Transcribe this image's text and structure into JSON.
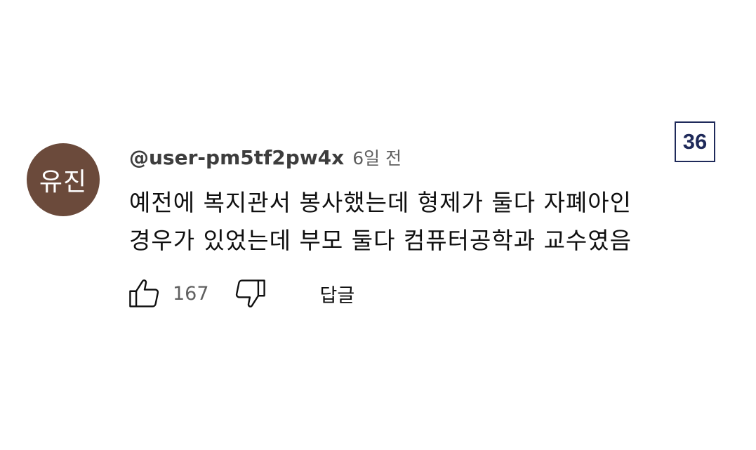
{
  "comment": {
    "avatar_text": "유진",
    "avatar_color": "#6b4a3b",
    "username": "@user-pm5tf2pw4x",
    "time": "6일 전",
    "text_lines": [
      "예전에 복지관서 봉사했는데 형제가 둘다 자폐아인",
      "경우가 있었는데 부모 둘다 컴퓨터공학과 교수였음"
    ],
    "like_icon": "thumbs-up-icon",
    "like_count": "167",
    "dislike_icon": "thumbs-down-icon",
    "reply_label": "답글"
  },
  "badge": {
    "number": "36",
    "color": "#1f2a5a"
  }
}
